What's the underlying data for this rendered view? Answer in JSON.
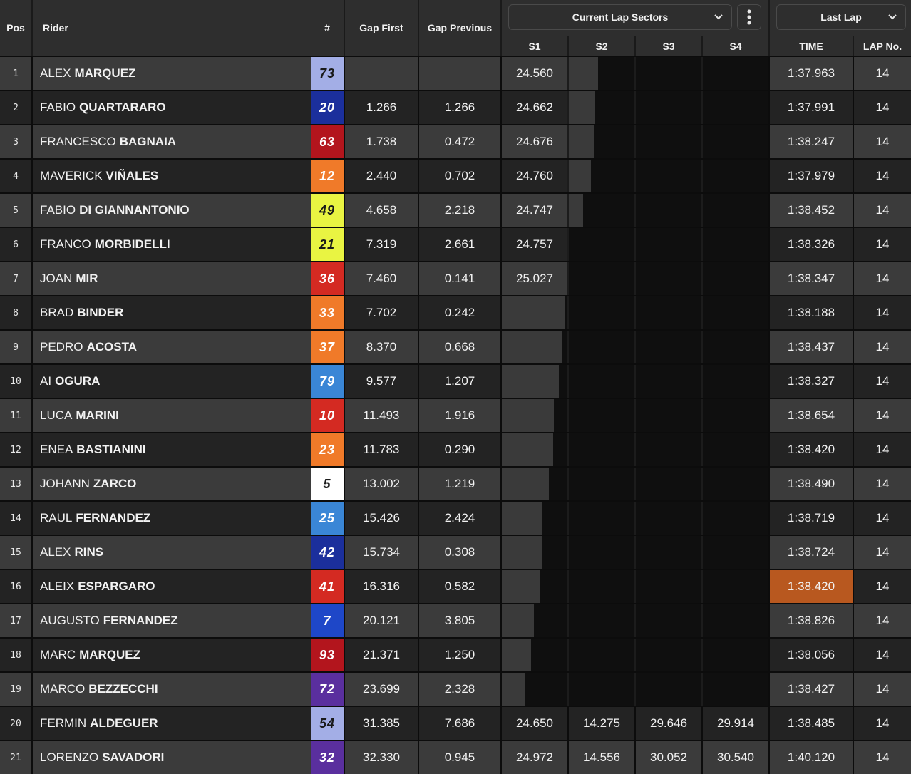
{
  "headers": {
    "pos": "Pos",
    "rider": "Rider",
    "number": "#",
    "gap_first": "Gap First",
    "gap_previous": "Gap Previous",
    "sectors_dropdown": "Current Lap Sectors",
    "s1": "S1",
    "s2": "S2",
    "s3": "S3",
    "s4": "S4",
    "last_lap_dropdown": "Last Lap",
    "time": "TIME",
    "lap_no": "LAP No."
  },
  "colors": {
    "row_light": "#3b3b3b",
    "row_dark": "#232323",
    "highlight_lap": "#b8581f"
  },
  "rows": [
    {
      "pos": "1",
      "first": "ALEX",
      "last": "MARQUEZ",
      "num": "73",
      "num_bg": "#a3aee6",
      "num_fg": "#1a1a1a",
      "gap_first": "",
      "gap_prev": "",
      "s1": "24.560",
      "s2": "",
      "s3": "",
      "s4": "",
      "sector_progress": 0.45,
      "time": "1:37.963",
      "lap": "14",
      "time_highlight": false
    },
    {
      "pos": "2",
      "first": "FABIO",
      "last": "QUARTARARO",
      "num": "20",
      "num_bg": "#1b2f9c",
      "num_fg": "#ffffff",
      "gap_first": "1.266",
      "gap_prev": "1.266",
      "s1": "24.662",
      "s2": "",
      "s3": "",
      "s4": "",
      "sector_progress": 0.4,
      "time": "1:37.991",
      "lap": "14",
      "time_highlight": false
    },
    {
      "pos": "3",
      "first": "FRANCESCO",
      "last": "BAGNAIA",
      "num": "63",
      "num_bg": "#b3151d",
      "num_fg": "#ffffff",
      "gap_first": "1.738",
      "gap_prev": "0.472",
      "s1": "24.676",
      "s2": "",
      "s3": "",
      "s4": "",
      "sector_progress": 0.38,
      "time": "1:38.247",
      "lap": "14",
      "time_highlight": false
    },
    {
      "pos": "4",
      "first": "MAVERICK",
      "last": "VIÑALES",
      "num": "12",
      "num_bg": "#f07a29",
      "num_fg": "#ffffff",
      "gap_first": "2.440",
      "gap_prev": "0.702",
      "s1": "24.760",
      "s2": "",
      "s3": "",
      "s4": "",
      "sector_progress": 0.34,
      "time": "1:37.979",
      "lap": "14",
      "time_highlight": false
    },
    {
      "pos": "5",
      "first": "FABIO",
      "last": "DI GIANNANTONIO",
      "num": "49",
      "num_bg": "#e9f442",
      "num_fg": "#1a1a1a",
      "gap_first": "4.658",
      "gap_prev": "2.218",
      "s1": "24.747",
      "s2": "",
      "s3": "",
      "s4": "",
      "sector_progress": 0.22,
      "time": "1:38.452",
      "lap": "14",
      "time_highlight": false
    },
    {
      "pos": "6",
      "first": "FRANCO",
      "last": "MORBIDELLI",
      "num": "21",
      "num_bg": "#e9f442",
      "num_fg": "#1a1a1a",
      "gap_first": "7.319",
      "gap_prev": "2.661",
      "s1": "24.757",
      "s2": "",
      "s3": "",
      "s4": "",
      "sector_progress": 0.0,
      "time": "1:38.326",
      "lap": "14",
      "time_highlight": false
    },
    {
      "pos": "7",
      "first": "JOAN",
      "last": "MIR",
      "num": "36",
      "num_bg": "#d42a22",
      "num_fg": "#ffffff",
      "gap_first": "7.460",
      "gap_prev": "0.141",
      "s1": "25.027",
      "s2": "",
      "s3": "",
      "s4": "",
      "sector_progress": 0.0,
      "time": "1:38.347",
      "lap": "14",
      "time_highlight": false
    },
    {
      "pos": "8",
      "first": "BRAD",
      "last": "BINDER",
      "num": "33",
      "num_bg": "#f07a29",
      "num_fg": "#ffffff",
      "gap_first": "7.702",
      "gap_prev": "0.242",
      "s1": "",
      "s2": "",
      "s3": "",
      "s4": "",
      "sector_progress": 0.96,
      "time": "1:38.188",
      "lap": "14",
      "time_highlight": false
    },
    {
      "pos": "9",
      "first": "PEDRO",
      "last": "ACOSTA",
      "num": "37",
      "num_bg": "#f07a29",
      "num_fg": "#ffffff",
      "gap_first": "8.370",
      "gap_prev": "0.668",
      "s1": "",
      "s2": "",
      "s3": "",
      "s4": "",
      "sector_progress": 0.92,
      "time": "1:38.437",
      "lap": "14",
      "time_highlight": false
    },
    {
      "pos": "10",
      "first": "AI",
      "last": "OGURA",
      "num": "79",
      "num_bg": "#3a86d6",
      "num_fg": "#ffffff",
      "gap_first": "9.577",
      "gap_prev": "1.207",
      "s1": "",
      "s2": "",
      "s3": "",
      "s4": "",
      "sector_progress": 0.87,
      "time": "1:38.327",
      "lap": "14",
      "time_highlight": false
    },
    {
      "pos": "11",
      "first": "LUCA",
      "last": "MARINI",
      "num": "10",
      "num_bg": "#d42a22",
      "num_fg": "#ffffff",
      "gap_first": "11.493",
      "gap_prev": "1.916",
      "s1": "",
      "s2": "",
      "s3": "",
      "s4": "",
      "sector_progress": 0.79,
      "time": "1:38.654",
      "lap": "14",
      "time_highlight": false
    },
    {
      "pos": "12",
      "first": "ENEA",
      "last": "BASTIANINI",
      "num": "23",
      "num_bg": "#f07a29",
      "num_fg": "#ffffff",
      "gap_first": "11.783",
      "gap_prev": "0.290",
      "s1": "",
      "s2": "",
      "s3": "",
      "s4": "",
      "sector_progress": 0.78,
      "time": "1:38.420",
      "lap": "14",
      "time_highlight": false
    },
    {
      "pos": "13",
      "first": "JOHANN",
      "last": "ZARCO",
      "num": "5",
      "num_bg": "#ffffff",
      "num_fg": "#1a1a1a",
      "gap_first": "13.002",
      "gap_prev": "1.219",
      "s1": "",
      "s2": "",
      "s3": "",
      "s4": "",
      "sector_progress": 0.72,
      "time": "1:38.490",
      "lap": "14",
      "time_highlight": false
    },
    {
      "pos": "14",
      "first": "RAUL",
      "last": "FERNANDEZ",
      "num": "25",
      "num_bg": "#3a86d6",
      "num_fg": "#ffffff",
      "gap_first": "15.426",
      "gap_prev": "2.424",
      "s1": "",
      "s2": "",
      "s3": "",
      "s4": "",
      "sector_progress": 0.62,
      "time": "1:38.719",
      "lap": "14",
      "time_highlight": false
    },
    {
      "pos": "15",
      "first": "ALEX",
      "last": "RINS",
      "num": "42",
      "num_bg": "#1b2f9c",
      "num_fg": "#ffffff",
      "gap_first": "15.734",
      "gap_prev": "0.308",
      "s1": "",
      "s2": "",
      "s3": "",
      "s4": "",
      "sector_progress": 0.61,
      "time": "1:38.724",
      "lap": "14",
      "time_highlight": false
    },
    {
      "pos": "16",
      "first": "ALEIX",
      "last": "ESPARGARO",
      "num": "41",
      "num_bg": "#d42a22",
      "num_fg": "#ffffff",
      "gap_first": "16.316",
      "gap_prev": "0.582",
      "s1": "",
      "s2": "",
      "s3": "",
      "s4": "",
      "sector_progress": 0.59,
      "time": "1:38.420",
      "lap": "14",
      "time_highlight": true
    },
    {
      "pos": "17",
      "first": "AUGUSTO",
      "last": "FERNANDEZ",
      "num": "7",
      "num_bg": "#1e47c8",
      "num_fg": "#ffffff",
      "gap_first": "20.121",
      "gap_prev": "3.805",
      "s1": "",
      "s2": "",
      "s3": "",
      "s4": "",
      "sector_progress": 0.49,
      "time": "1:38.826",
      "lap": "14",
      "time_highlight": false
    },
    {
      "pos": "18",
      "first": "MARC",
      "last": "MARQUEZ",
      "num": "93",
      "num_bg": "#b3151d",
      "num_fg": "#ffffff",
      "gap_first": "21.371",
      "gap_prev": "1.250",
      "s1": "",
      "s2": "",
      "s3": "",
      "s4": "",
      "sector_progress": 0.45,
      "time": "1:38.056",
      "lap": "14",
      "time_highlight": false
    },
    {
      "pos": "19",
      "first": "MARCO",
      "last": "BEZZECCHI",
      "num": "72",
      "num_bg": "#5a2f9e",
      "num_fg": "#ffffff",
      "gap_first": "23.699",
      "gap_prev": "2.328",
      "s1": "",
      "s2": "",
      "s3": "",
      "s4": "",
      "sector_progress": 0.36,
      "time": "1:38.427",
      "lap": "14",
      "time_highlight": false
    },
    {
      "pos": "20",
      "first": "FERMIN",
      "last": "ALDEGUER",
      "num": "54",
      "num_bg": "#a3aee6",
      "num_fg": "#1a1a1a",
      "gap_first": "31.385",
      "gap_prev": "7.686",
      "s1": "24.650",
      "s2": "14.275",
      "s3": "29.646",
      "s4": "29.914",
      "sector_progress": 0.0,
      "time": "1:38.485",
      "lap": "14",
      "time_highlight": false
    },
    {
      "pos": "21",
      "first": "LORENZO",
      "last": "SAVADORI",
      "num": "32",
      "num_bg": "#5a2f9e",
      "num_fg": "#ffffff",
      "gap_first": "32.330",
      "gap_prev": "0.945",
      "s1": "24.972",
      "s2": "14.556",
      "s3": "30.052",
      "s4": "30.540",
      "sector_progress": 0.0,
      "time": "1:40.120",
      "lap": "14",
      "time_highlight": false
    }
  ]
}
